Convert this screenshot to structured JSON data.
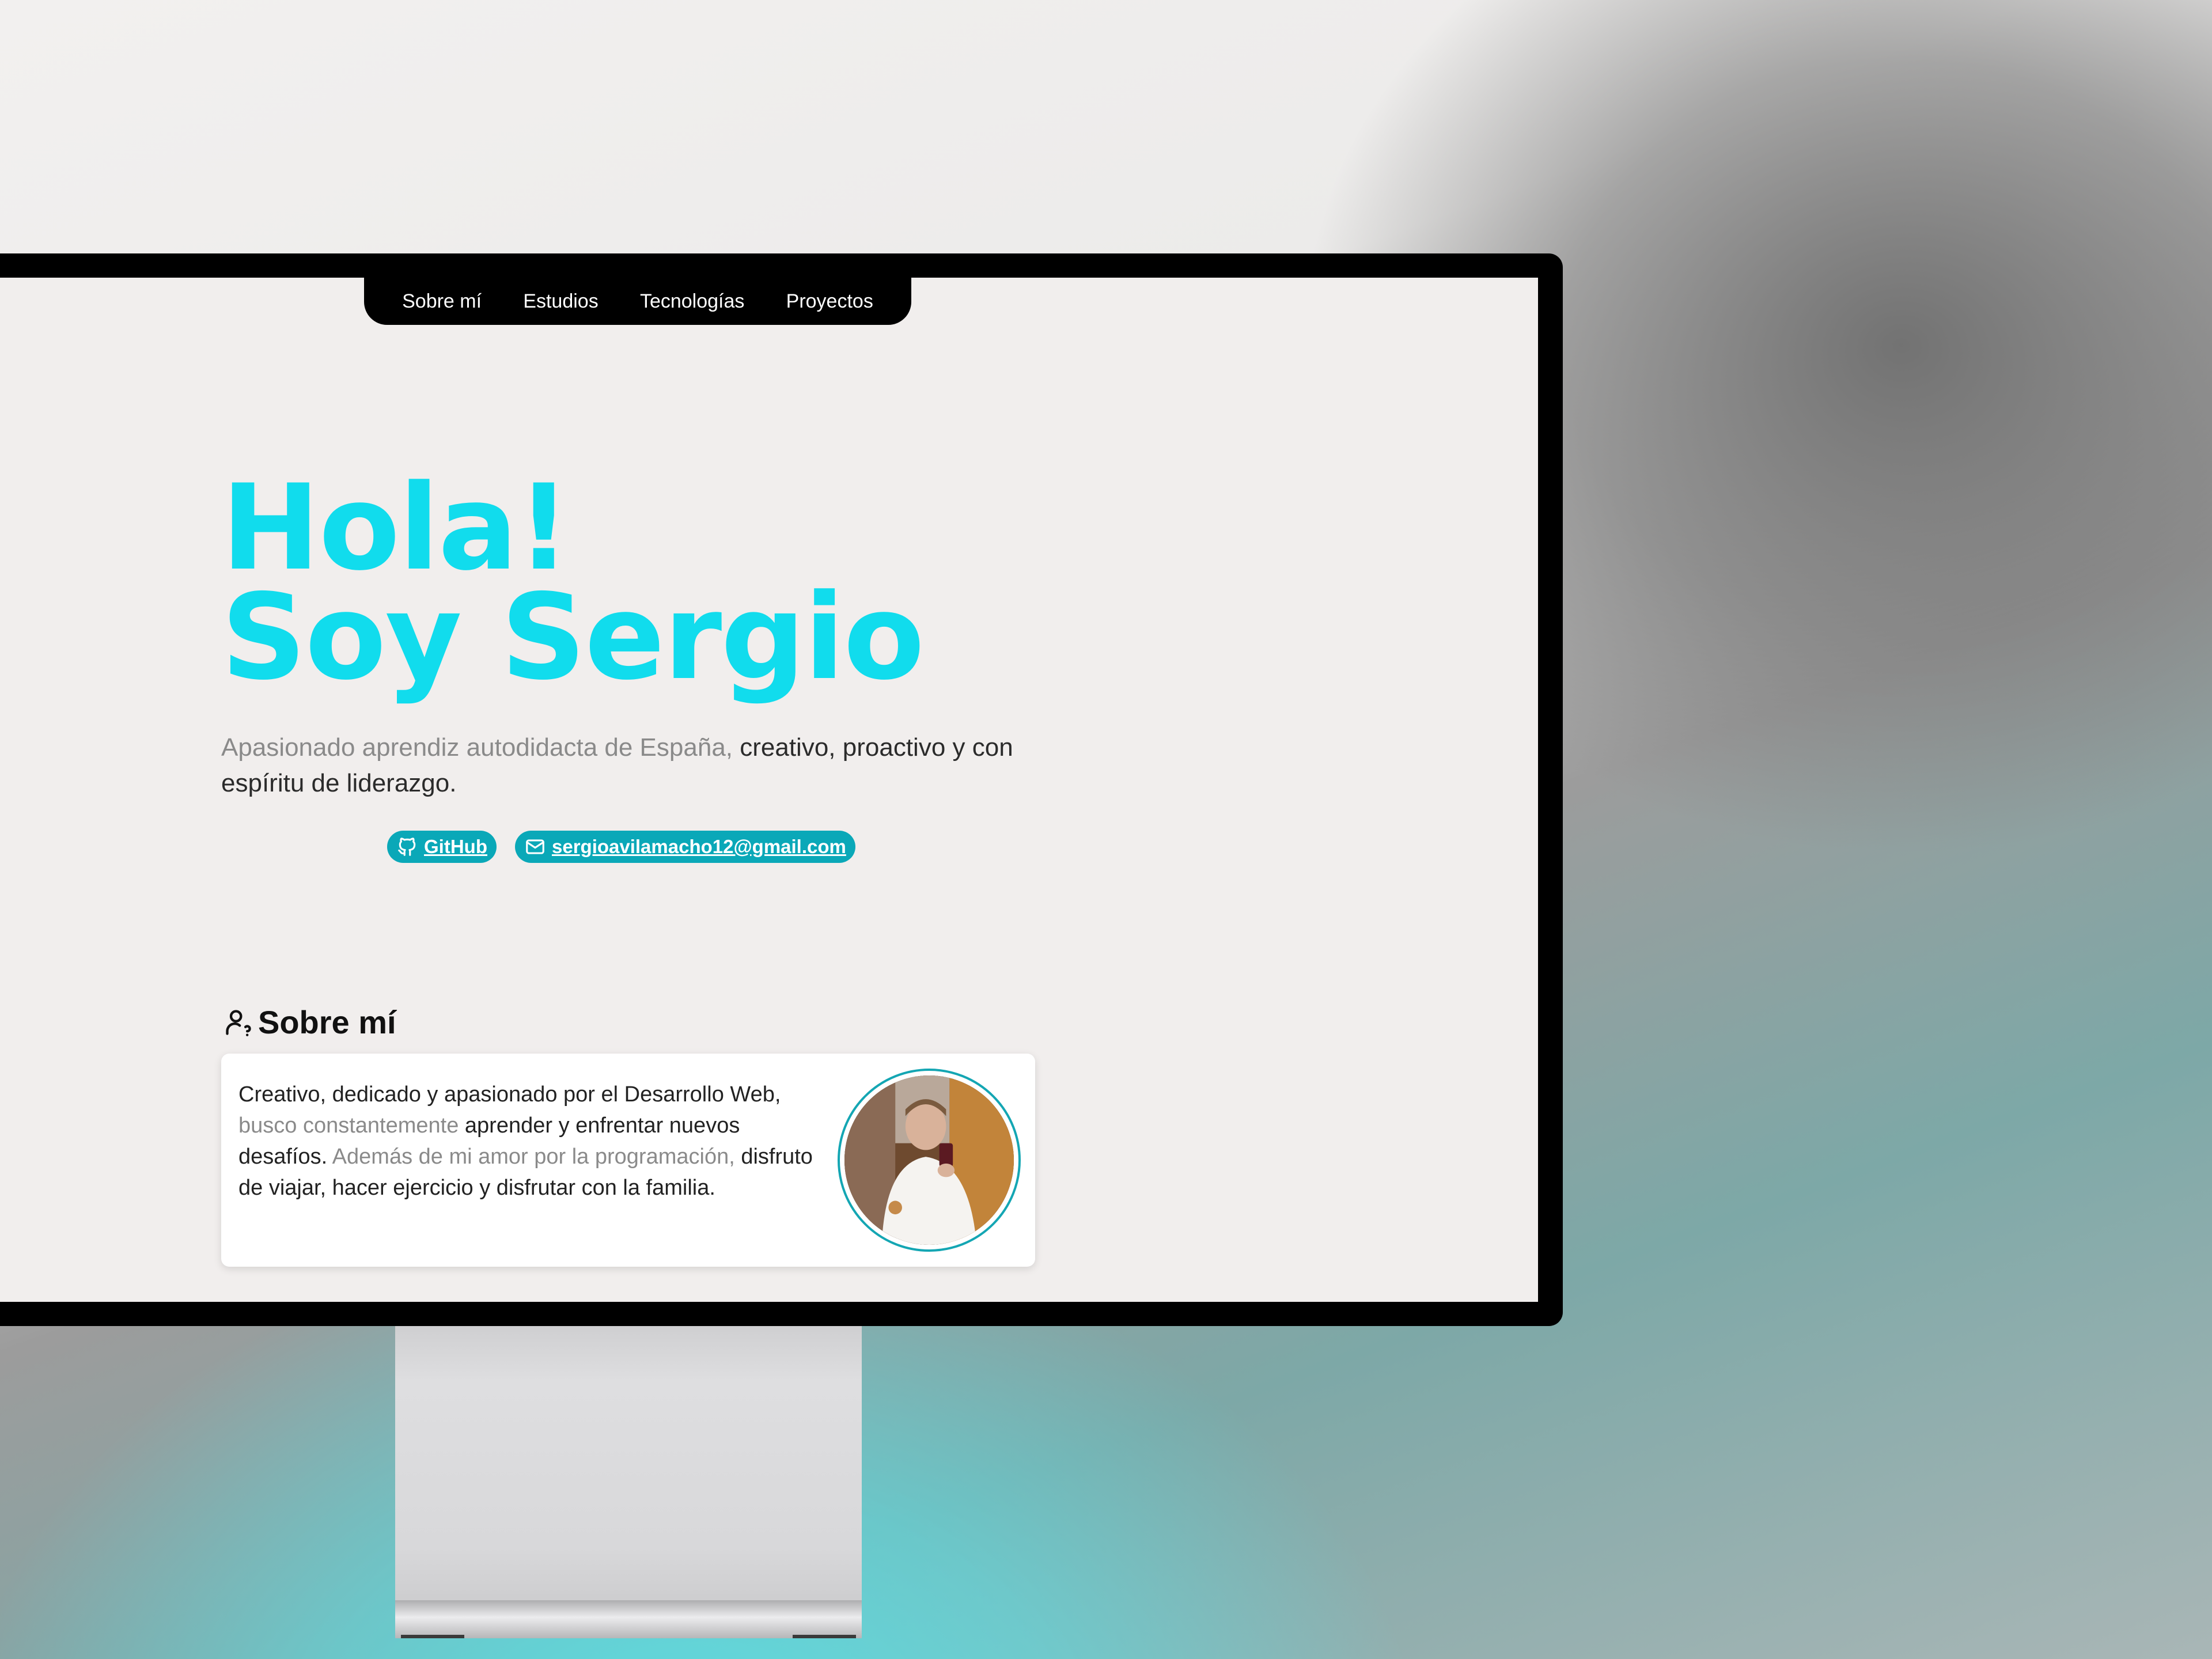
{
  "nav": {
    "items": [
      "Sobre mí",
      "Estudios",
      "Tecnologías",
      "Proyectos"
    ]
  },
  "hero": {
    "line1": "Hola!",
    "line2": "Soy Sergio",
    "desc_muted": "Apasionado aprendiz autodidacta de España,",
    "desc_strong": " creativo, proactivo y con espíritu de liderazgo."
  },
  "badges": {
    "github": "GitHub",
    "email": "sergioavilamacho12@gmail.com"
  },
  "about": {
    "title": "Sobre mí",
    "t1": "Creativo, dedicado y apasionado por el Desarrollo Web, ",
    "t2_muted": "busco constantemente",
    "t3": " aprender y enfrentar nuevos desafíos.",
    "t4_muted": " Además de mi amor por la programación,",
    "t5": " disfruto de viajar, hacer ejercicio y disfrutar con la familia."
  },
  "colors": {
    "accent": "#11dced",
    "badge": "#0aa8b8",
    "nav_bg": "#000000",
    "screen_bg": "#f1eeed"
  },
  "icons": [
    "github-icon",
    "mail-icon",
    "user-icon"
  ]
}
